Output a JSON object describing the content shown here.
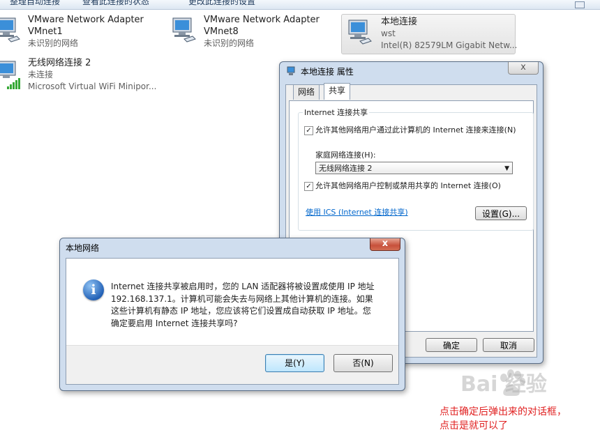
{
  "toolbar": {
    "items": [
      "整理自动连接",
      "查看此连接的状态",
      "更改此连接的设置"
    ]
  },
  "adapters": [
    {
      "name": "VMware Network Adapter",
      "line2": "VMnet1",
      "line3": "未识别的网络"
    },
    {
      "name": "VMware Network Adapter",
      "line2": "VMnet8",
      "line3": "未识别的网络"
    },
    {
      "name": "本地连接",
      "line2": "wst",
      "line3": "Intel(R) 82579LM Gigabit Netw..."
    },
    {
      "name": "无线网络连接 2",
      "line2": "未连接",
      "line3": "Microsoft Virtual WiFi Minipor..."
    }
  ],
  "props_dialog": {
    "title": "本地连接 属性",
    "tabs": [
      "网络",
      "共享"
    ],
    "group_title": "Internet 连接共享",
    "allow_share_label": "允许其他网络用户通过此计算机的 Internet 连接来连接(N)",
    "home_network_label": "家庭网络连接(H):",
    "home_network_value": "无线网络连接 2",
    "allow_control_label": "允许其他网络用户控制或禁用共享的 Internet 连接(O)",
    "ics_link": "使用 ICS (Internet 连接共享)",
    "settings_button": "设置(G)...",
    "ok_button": "确定",
    "cancel_button": "取消",
    "close_symbol": "x"
  },
  "message_box": {
    "title": "本地网络",
    "message_lines": [
      "Internet 连接共享被启用时，您的 LAN 适配器将被设置成使用 IP 地址",
      "192.168.137.1。计算机可能会失去与网络上其他计算机的连接。如果",
      "这些计算机有静态 IP 地址，您应该将它们设置成自动获取 IP 地址。您",
      "确定要启用 Internet 连接共享吗?"
    ],
    "yes_button": "是(Y)",
    "no_button": "否(N)",
    "close_symbol": "x",
    "icon_glyph": "i"
  },
  "watermark": "Bai  经验",
  "annotation": {
    "line1": "点击确定后弹出来的对话框，",
    "line2": "点击是就可以了"
  }
}
